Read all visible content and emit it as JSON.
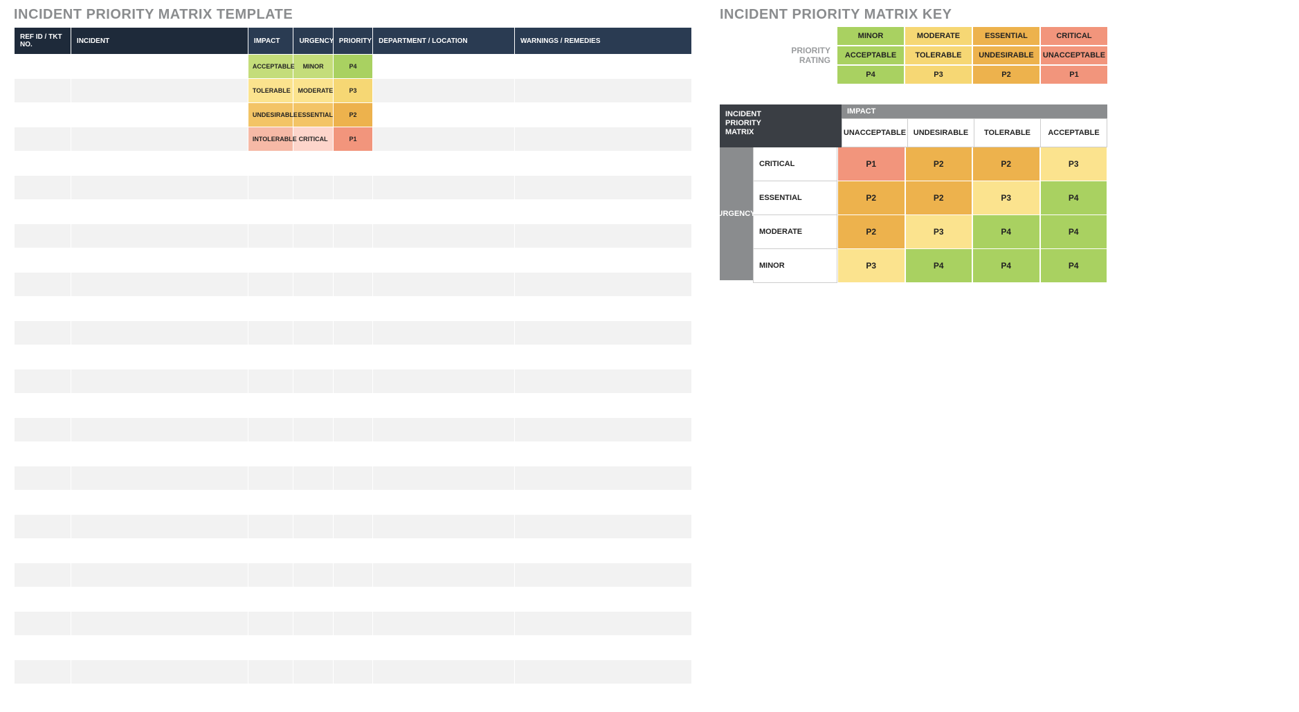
{
  "template": {
    "title": "INCIDENT PRIORITY MATRIX TEMPLATE",
    "headers": {
      "ref": "REF ID / TKT NO.",
      "incident": "INCIDENT",
      "impact": "IMPACT",
      "urgency": "URGENCY",
      "priority": "PRIORITY",
      "dept": "DEPARTMENT / LOCATION",
      "warn": "WARNINGS / REMEDIES"
    },
    "rows": [
      {
        "impact": "ACCEPTABLE",
        "urgency": "MINOR",
        "priority": "P4",
        "ic": "c-green-l",
        "uc": "c-green-l",
        "pc": "c-green"
      },
      {
        "impact": "TOLERABLE",
        "urgency": "MODERATE",
        "priority": "P3",
        "ic": "c-yellow-l",
        "uc": "c-yellow-l",
        "pc": "c-yellow"
      },
      {
        "impact": "UNDESIRABLE",
        "urgency": "ESSENTIAL",
        "priority": "P2",
        "ic": "c-orange-l",
        "uc": "c-orange-l",
        "pc": "c-orange"
      },
      {
        "impact": "INTOLERABLE",
        "urgency": "CRITICAL",
        "priority": "P1",
        "ic": "c-red-l",
        "uc": "c-pink",
        "pc": "c-red"
      }
    ],
    "emptyRows": 22
  },
  "key": {
    "title": "INCIDENT PRIORITY MATRIX KEY",
    "ratingLabel": "PRIORITY RATING",
    "columns": [
      {
        "sev": "MINOR",
        "imp": "ACCEPTABLE",
        "p": "P4",
        "c": "c-green"
      },
      {
        "sev": "MODERATE",
        "imp": "TOLERABLE",
        "p": "P3",
        "c": "c-yellow"
      },
      {
        "sev": "ESSENTIAL",
        "imp": "UNDESIRABLE",
        "p": "P2",
        "c": "c-orange"
      },
      {
        "sev": "CRITICAL",
        "imp": "UNACCEPTABLE",
        "p": "P1",
        "c": "c-red"
      }
    ]
  },
  "matrix": {
    "corner": "INCIDENT PRIORITY MATRIX",
    "impactLabel": "IMPACT",
    "urgencyLabel": "URGENCY",
    "impactHeaders": [
      "UNACCEPTABLE",
      "UNDESIRABLE",
      "TOLERABLE",
      "ACCEPTABLE"
    ],
    "rows": [
      {
        "label": "CRITICAL",
        "cells": [
          {
            "v": "P1",
            "c": "c-red"
          },
          {
            "v": "P2",
            "c": "c-orange"
          },
          {
            "v": "P2",
            "c": "c-orange"
          },
          {
            "v": "P3",
            "c": "c-yellow-l"
          }
        ]
      },
      {
        "label": "ESSENTIAL",
        "cells": [
          {
            "v": "P2",
            "c": "c-orange"
          },
          {
            "v": "P2",
            "c": "c-orange"
          },
          {
            "v": "P3",
            "c": "c-yellow-l"
          },
          {
            "v": "P4",
            "c": "c-green"
          }
        ]
      },
      {
        "label": "MODERATE",
        "cells": [
          {
            "v": "P2",
            "c": "c-orange"
          },
          {
            "v": "P3",
            "c": "c-yellow-l"
          },
          {
            "v": "P4",
            "c": "c-green"
          },
          {
            "v": "P4",
            "c": "c-green"
          }
        ]
      },
      {
        "label": "MINOR",
        "cells": [
          {
            "v": "P3",
            "c": "c-yellow-l"
          },
          {
            "v": "P4",
            "c": "c-green"
          },
          {
            "v": "P4",
            "c": "c-green"
          },
          {
            "v": "P4",
            "c": "c-green"
          }
        ]
      }
    ]
  }
}
